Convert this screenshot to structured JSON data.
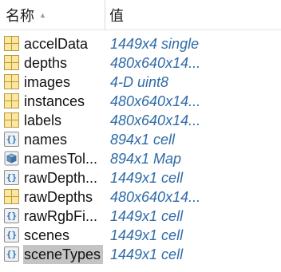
{
  "header": {
    "name_label": "名称",
    "value_label": "值",
    "sort_indicator": "▲"
  },
  "variables": [
    {
      "name": "accelData",
      "value": "1449x4 single",
      "icon": "matrix-icon",
      "selected": false
    },
    {
      "name": "depths",
      "value": "480x640x14...",
      "icon": "matrix-icon",
      "selected": false
    },
    {
      "name": "images",
      "value": "4-D uint8",
      "icon": "matrix-icon",
      "selected": false
    },
    {
      "name": "instances",
      "value": "480x640x14...",
      "icon": "matrix-icon",
      "selected": false
    },
    {
      "name": "labels",
      "value": "480x640x14...",
      "icon": "matrix-icon",
      "selected": false
    },
    {
      "name": "names",
      "value": "894x1 cell",
      "icon": "cell-icon",
      "selected": false
    },
    {
      "name": "namesTol...",
      "value": "894x1 Map",
      "icon": "map-icon",
      "selected": false
    },
    {
      "name": "rawDepth...",
      "value": "1449x1 cell",
      "icon": "cell-icon",
      "selected": false
    },
    {
      "name": "rawDepths",
      "value": "480x640x14...",
      "icon": "matrix-icon",
      "selected": false
    },
    {
      "name": "rawRgbFi...",
      "value": "1449x1 cell",
      "icon": "cell-icon",
      "selected": false
    },
    {
      "name": "scenes",
      "value": "1449x1 cell",
      "icon": "cell-icon",
      "selected": false
    },
    {
      "name": "sceneTypes",
      "value": "1449x1 cell",
      "icon": "cell-icon",
      "selected": true
    }
  ],
  "colors": {
    "value_text": "#2e6ba8",
    "selected_background": "#c4c4c4",
    "matrix_icon_fill": "#fbe7a0"
  }
}
